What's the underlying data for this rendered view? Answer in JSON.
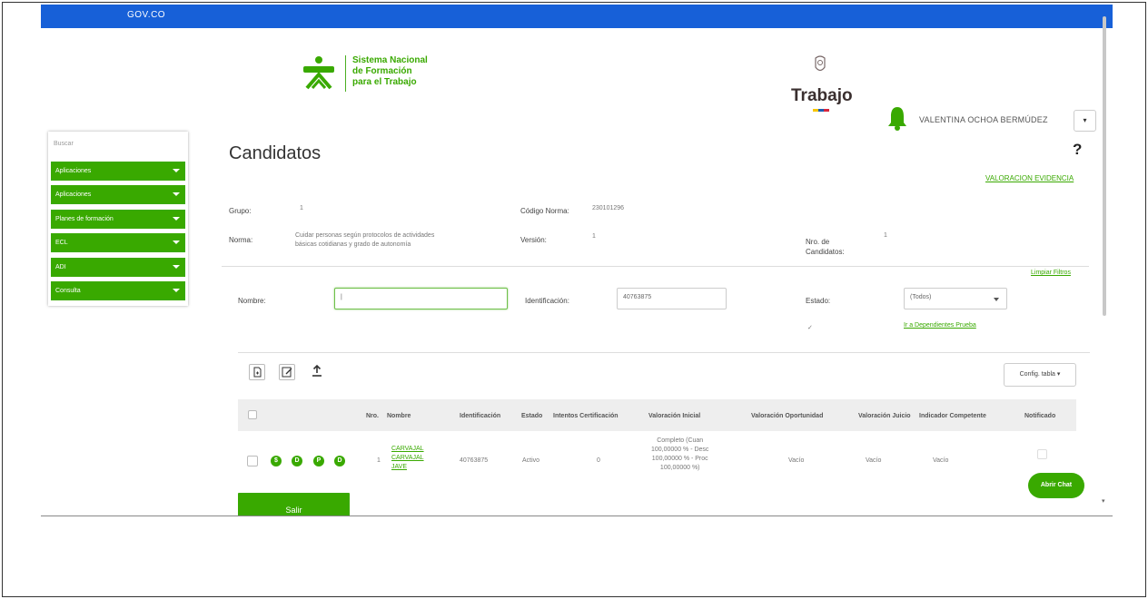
{
  "header": {
    "gov_logo": "GOV.CO",
    "sena_lines": [
      "Sistema Nacional",
      "de Formación",
      "para el Trabajo"
    ],
    "ministry": "Trabajo",
    "user": {
      "name": "VALENTINA OCHOA BERMÚDEZ",
      "caret": "▾"
    }
  },
  "sidebar": {
    "search_placeholder": "Buscar",
    "items": [
      {
        "label": "Aplicaciones"
      },
      {
        "label": "Aplicaciones"
      },
      {
        "label": "Planes de formación"
      },
      {
        "label": "ECL"
      },
      {
        "label": "ADI"
      },
      {
        "label": "Consulta"
      }
    ]
  },
  "page": {
    "title": "Candidatos",
    "help": "?",
    "valoracion_link": "VALORACION EVIDENCIA"
  },
  "info": {
    "grupo_label": "Grupo:",
    "grupo_value": "1",
    "norma_label": "Norma:",
    "norma_value_1": "Cuidar personas según protocolos de actividades",
    "norma_value_2": "básicas cotidianas y grado de autonomía",
    "codigo_label": "Código Norma:",
    "codigo_value": "230101296",
    "version_label": "Versión:",
    "version_value": "1",
    "candidatos_label_1": "Nro. de",
    "candidatos_label_2": "Candidatos:",
    "candidatos_value": "1"
  },
  "filters": {
    "clear": "Limpiar Filtros",
    "nombre_label": "Nombre:",
    "nombre_value": "|",
    "identificacion_label": "Identificación:",
    "identificacion_value": "40763875",
    "estado_label": "Estado:",
    "estado_value": "(Todos)",
    "mark": "✓",
    "dependientes_link": "Ir a Dependientes Prueba"
  },
  "toolbar": {
    "config": "Config. tabla ▾"
  },
  "table": {
    "headers": [
      "Nro.",
      "Nombre",
      "Identificación",
      "Estado",
      "Intentos Certificación",
      "Valoración Inicial",
      "Valoración Oportunidad",
      "Valoración Juicio",
      "Indicador Competente",
      "Notificado"
    ],
    "row": {
      "actions": [
        "$",
        "D",
        "P",
        "D"
      ],
      "nro": "1",
      "nombre": [
        "CARVAJAL",
        "CARVAJAL",
        "JAVE"
      ],
      "identificacion": "40763875",
      "estado": "Activo",
      "intentos": "0",
      "valoracion_inicial": [
        "Completo (Cuan",
        "100,00000 % - Desc",
        "100,00000 % - Proc",
        "100,00000 %)"
      ],
      "oportunidad": "Vacío",
      "juicio": "Vacío",
      "indicador": "Vacío"
    }
  },
  "buttons": {
    "salir": "Salir",
    "chat": "Abrir Chat"
  },
  "colors": {
    "gov_blue": "#1760d8",
    "sena_green": "#39a900"
  }
}
